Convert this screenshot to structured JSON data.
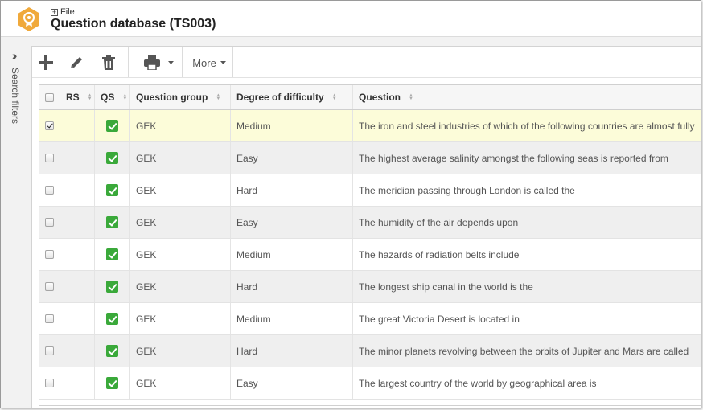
{
  "header": {
    "breadcrumb": "File",
    "title": "Question database (TS003)"
  },
  "sidebar": {
    "label": "Search filters"
  },
  "toolbar": {
    "more_label": "More"
  },
  "table": {
    "columns": {
      "rs": "RS",
      "qs": "QS",
      "group": "Question group",
      "difficulty": "Degree of difficulty",
      "question": "Question"
    },
    "rows": [
      {
        "checked": true,
        "group": "GEK",
        "difficulty": "Medium",
        "question": "The iron and steel industries of which of the following countries are almost fully"
      },
      {
        "checked": false,
        "group": "GEK",
        "difficulty": "Easy",
        "question": "The highest average salinity amongst the following seas is reported from"
      },
      {
        "checked": false,
        "group": "GEK",
        "difficulty": "Hard",
        "question": "The meridian passing through London is called the"
      },
      {
        "checked": false,
        "group": "GEK",
        "difficulty": "Easy",
        "question": "The humidity of the air depends upon"
      },
      {
        "checked": false,
        "group": "GEK",
        "difficulty": "Medium",
        "question": "The hazards of radiation belts include"
      },
      {
        "checked": false,
        "group": "GEK",
        "difficulty": "Hard",
        "question": "The longest ship canal in the world is the"
      },
      {
        "checked": false,
        "group": "GEK",
        "difficulty": "Medium",
        "question": "The great Victoria Desert is located in"
      },
      {
        "checked": false,
        "group": "GEK",
        "difficulty": "Hard",
        "question": "The minor planets revolving between the orbits of Jupiter and Mars are called"
      },
      {
        "checked": false,
        "group": "GEK",
        "difficulty": "Easy",
        "question": "The largest country of the world by geographical area is"
      }
    ]
  },
  "colors": {
    "accent_icon": "#f0a93b",
    "qs_check": "#3aa93a",
    "selected_row": "#fcfcd9"
  }
}
